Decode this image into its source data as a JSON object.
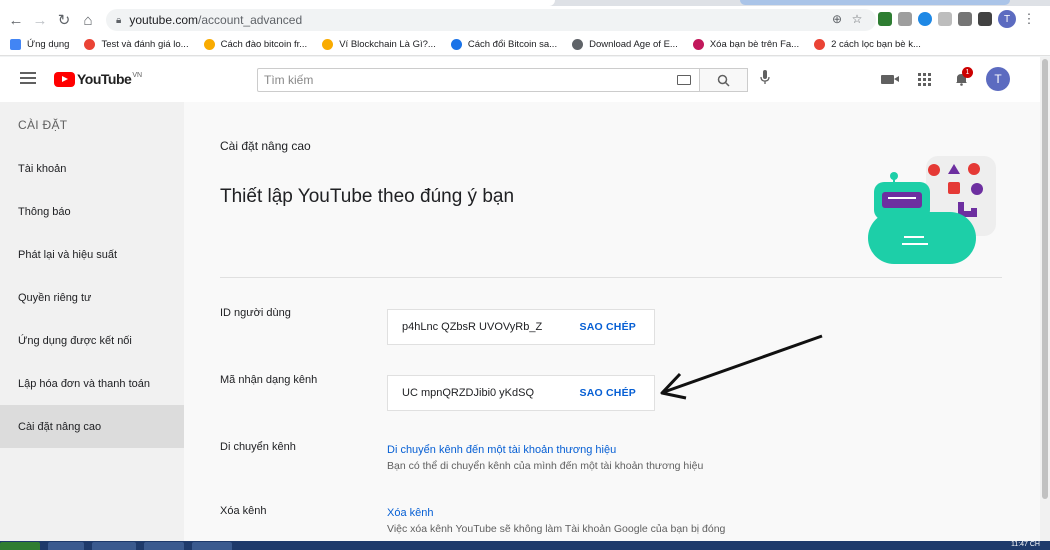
{
  "browser": {
    "url_host": "youtube.com",
    "url_path": "/account_advanced",
    "bookmarks": [
      {
        "label": "Ứng dụng",
        "color": "#4285f4"
      },
      {
        "label": "Test và đánh giá lo...",
        "color": "#ea4335"
      },
      {
        "label": "Cách đào bitcoin fr...",
        "color": "#f9ab00"
      },
      {
        "label": "Ví Blockchain Là Gì?...",
        "color": "#f9ab00"
      },
      {
        "label": "Cách đổi Bitcoin sa...",
        "color": "#1a73e8"
      },
      {
        "label": "Download Age of E...",
        "color": "#5f6368"
      },
      {
        "label": "Xóa bạn bè trên Fa...",
        "color": "#c2185b"
      },
      {
        "label": "2 cách lọc bạn bè k...",
        "color": "#ea4335"
      }
    ],
    "profile_initial": "T"
  },
  "header": {
    "logo_text": "YouTube",
    "region": "VN",
    "search_placeholder": "Tìm kiếm",
    "notification_count": "1",
    "avatar_initial": "T"
  },
  "sidebar": {
    "heading": "CÀI ĐẶT",
    "items": [
      {
        "label": "Tài khoản"
      },
      {
        "label": "Thông báo"
      },
      {
        "label": "Phát lại và hiệu suất"
      },
      {
        "label": "Quyền riêng tư"
      },
      {
        "label": "Ứng dụng được kết nối"
      },
      {
        "label": "Lập hóa đơn và thanh toán"
      },
      {
        "label": "Cài đặt nâng cao"
      }
    ]
  },
  "main": {
    "eyebrow": "Cài đặt nâng cao",
    "headline": "Thiết lập YouTube theo đúng ý bạn",
    "user_id": {
      "label": "ID người dùng",
      "value": "p4hLnc  QZbsR  UVOVyRb_Z",
      "copy_label": "SAO CHÉP"
    },
    "channel_id": {
      "label": "Mã nhận dạng kênh",
      "value": "UC         mpnQRZDJibi0         yKdSQ",
      "copy_label": "SAO CHÉP"
    },
    "move_channel": {
      "label": "Di chuyển kênh",
      "link": "Di chuyển kênh đến một tài khoản thương hiệu",
      "description": "Bạn có thể di chuyển kênh của mình đến một tài khoản thương hiệu"
    },
    "delete_channel": {
      "label": "Xóa kênh",
      "link": "Xóa kênh",
      "description": "Việc xóa kênh YouTube sẽ không làm Tài khoản Google của bạn bị đóng"
    }
  },
  "taskbar": {
    "clock": "11:47 CH"
  },
  "colors": {
    "link": "#065fd4",
    "youtube_red": "#ff0000",
    "illustration_teal": "#1dcfa8",
    "illustration_purple": "#6d2fa0"
  }
}
